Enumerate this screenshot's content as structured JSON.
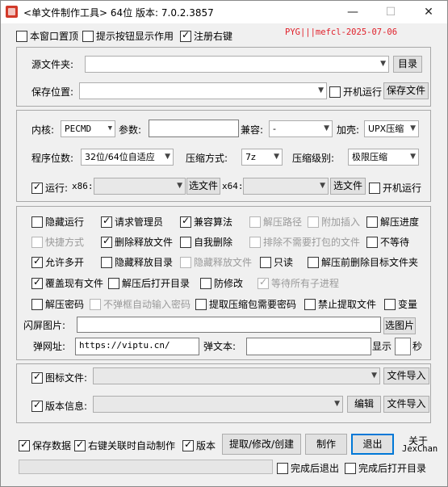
{
  "window": {
    "title": "<单文件制作工具> 64位 版本: 7.0.2.3857",
    "controls": {
      "minimize": "—",
      "maximize": "☐",
      "close": "✕"
    }
  },
  "top_options": [
    {
      "label": "本窗口置顶",
      "checked": false
    },
    {
      "label": "提示按钮显示作用",
      "checked": false
    },
    {
      "label": "注册右键",
      "checked": true
    }
  ],
  "watermark": "PYG|||mefcl-2025-07-06",
  "source": {
    "label": "源文件夹:",
    "value": "",
    "browse": "目录"
  },
  "save": {
    "label": "保存位置:",
    "value": "",
    "startup": {
      "label": "开机运行",
      "checked": false
    },
    "save_file": "保存文件"
  },
  "options": {
    "kernel_label": "内核:",
    "kernel_value": "PECMD",
    "params_label": "参数:",
    "params_value": "",
    "compat_label": "兼容:",
    "compat_value": "-",
    "shell_label": "加壳:",
    "shell_value": "UPX压缩",
    "bits_label": "程序位数:",
    "bits_value": "32位/64位自适应",
    "method_label": "压缩方式:",
    "method_value": "7z",
    "level_label": "压缩级别:",
    "level_value": "极限压缩",
    "run_label": "运行:",
    "run_checked": true,
    "x86_label": "x86:",
    "x86_value": "",
    "x86_btn": "选文件",
    "x64_label": "x64:",
    "x64_value": "",
    "x64_btn": "选文件",
    "startup": {
      "label": "开机运行",
      "checked": false
    }
  },
  "flags": [
    {
      "label": "隐藏运行",
      "checked": false,
      "disabled": false
    },
    {
      "label": "请求管理员",
      "checked": true,
      "disabled": false
    },
    {
      "label": "兼容算法",
      "checked": true,
      "disabled": false
    },
    {
      "label": "解压路径",
      "checked": false,
      "disabled": true
    },
    {
      "label": "附加插入",
      "checked": false,
      "disabled": true
    },
    {
      "label": "解压进度",
      "checked": false,
      "disabled": false
    },
    {
      "label": "快捷方式",
      "checked": false,
      "disabled": true
    },
    {
      "label": "删除释放文件",
      "checked": true,
      "disabled": false
    },
    {
      "label": "自我删除",
      "checked": false,
      "disabled": false
    },
    {
      "label": "排除不需要打包的文件",
      "checked": false,
      "disabled": true
    },
    {
      "label": "不等待",
      "checked": false,
      "disabled": false
    },
    {
      "label": "允许多开",
      "checked": true,
      "disabled": false
    },
    {
      "label": "隐藏释放目录",
      "checked": false,
      "disabled": false
    },
    {
      "label": "隐藏释放文件",
      "checked": false,
      "disabled": true
    },
    {
      "label": "只读",
      "checked": false,
      "disabled": false
    },
    {
      "label": "解压前删除目标文件夹",
      "checked": false,
      "disabled": false
    },
    {
      "label": "覆盖现有文件",
      "checked": true,
      "disabled": false
    },
    {
      "label": "解压后打开目录",
      "checked": false,
      "disabled": false
    },
    {
      "label": "防修改",
      "checked": false,
      "disabled": false
    },
    {
      "label": "等待所有子进程",
      "checked": true,
      "disabled": true
    },
    {
      "label": "解压密码",
      "checked": false,
      "disabled": false
    },
    {
      "label": "不弹框自动输入密码",
      "checked": false,
      "disabled": true
    },
    {
      "label": "提取压缩包需要密码",
      "checked": false,
      "disabled": false
    },
    {
      "label": "禁止提取文件",
      "checked": false,
      "disabled": false
    },
    {
      "label": "变量",
      "checked": false,
      "disabled": false
    }
  ],
  "splash": {
    "label": "闪屏图片:",
    "value": "",
    "btn": "选图片",
    "url_label": "弹网址:",
    "url_value": "https://viptu.cn/",
    "text_label": "弹文本:",
    "text_value": "",
    "show_label": "显示",
    "seconds_value": "",
    "seconds_unit": "秒"
  },
  "icon": {
    "label": "图标文件:",
    "checked": true,
    "value": "",
    "btn": "文件导入"
  },
  "version": {
    "label": "版本信息:",
    "checked": true,
    "value": "",
    "edit": "编辑",
    "btn": "文件导入"
  },
  "bottom": {
    "save_data": {
      "label": "保存数据",
      "checked": true
    },
    "auto_make": {
      "label": "右键关联时自动制作",
      "checked": true
    },
    "ver": {
      "label": "版本",
      "checked": true
    },
    "extract_btn": "提取/修改/创建",
    "make_btn": "制作",
    "exit_btn": "退出",
    "about": "关于",
    "author": "JexChan",
    "exit_after": {
      "label": "完成后退出",
      "checked": false
    },
    "open_after": {
      "label": "完成后打开目录",
      "checked": false
    }
  },
  "colors": {
    "watermark": "#e0202a",
    "title_bg": "#ffffff",
    "window_bg": "#f0f0f0",
    "focus_border": "#0078d7"
  }
}
